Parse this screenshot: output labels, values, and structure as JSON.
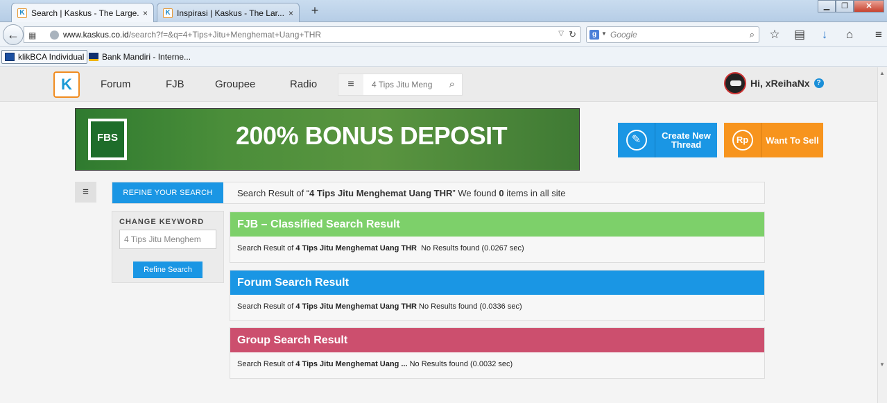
{
  "browser": {
    "tabs": [
      {
        "title": "Search | Kaskus - The Large...",
        "close": "×"
      },
      {
        "title": "Inspirasi | Kaskus - The Lar...",
        "close": "×"
      }
    ],
    "new_tab": "+",
    "window_buttons": {
      "minimize": "▁",
      "maximize": "❐",
      "close": "✕"
    },
    "address": {
      "domain": "www.kaskus.co.id",
      "path": "/search?f=&q=4+Tips+Jitu+Menghemat+Uang+THR"
    },
    "search": {
      "engine_letter": "g",
      "placeholder": "Google"
    },
    "bookmarks": [
      {
        "label": "klikBCA Individual"
      },
      {
        "label": "Bank Mandiri - Interne..."
      }
    ]
  },
  "kaskus": {
    "logo": "K",
    "nav": [
      "Forum",
      "FJB",
      "Groupee",
      "Radio"
    ],
    "search_query": "4 Tips Jitu Meng",
    "user_greeting": "Hi, xReihaNx",
    "help": "?"
  },
  "banner": {
    "brand": "FBS",
    "headline": "200% BONUS DEPOSIT"
  },
  "actions": {
    "create_thread": "Create New Thread",
    "create_icon": "✎",
    "sell": "Want To Sell",
    "sell_icon": "Rp"
  },
  "sidebar_toggle": "≡",
  "results": {
    "refine_tab": "REFINE YOUR SEARCH",
    "summary_prefix": "Search Result of “",
    "query": "4 Tips Jitu Menghemat Uang THR",
    "summary_mid": "” We found ",
    "count": "0",
    "summary_suffix": " items in all site",
    "change_keyword": "CHANGE KEYWORD",
    "keyword_value": "4 Tips Jitu Menghem",
    "refine_button": "Refine Search",
    "sections": [
      {
        "title": "FJB – Classified Search Result",
        "color": "#7dd06a",
        "prefix": "Search Result of ",
        "query": "4 Tips Jitu Menghemat Uang THR",
        "status": "  No Results found (0.0267 sec)"
      },
      {
        "title": "Forum Search Result",
        "color": "#1a96e4",
        "prefix": "Search Result of ",
        "query": "4 Tips Jitu Menghemat Uang THR",
        "status": " No Results found (0.0336 sec)"
      },
      {
        "title": "Group Search Result",
        "color": "#cc4f6e",
        "prefix": "Search Result of ",
        "query": "4 Tips Jitu Menghemat Uang ...",
        "status": " No Results found (0.0032 sec)"
      }
    ]
  }
}
